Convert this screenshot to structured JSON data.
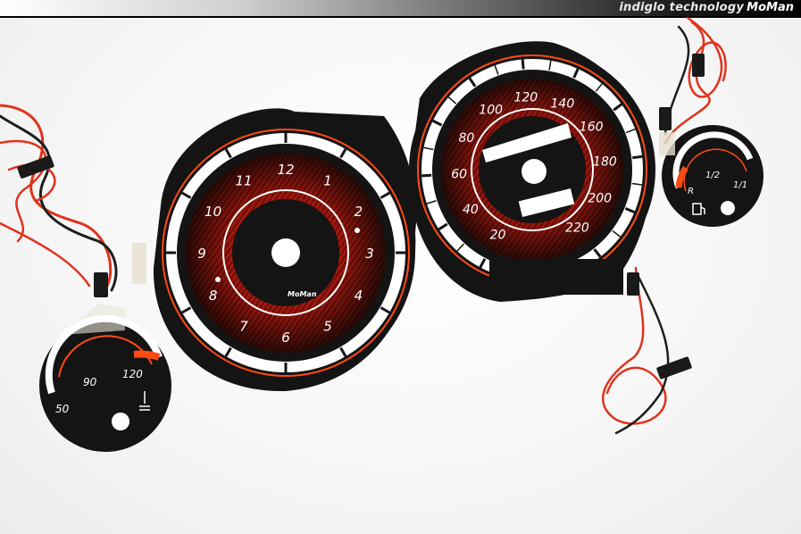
{
  "header": {
    "brand_text": "indiglo technology",
    "logo_text": "MoMan"
  },
  "clock": {
    "numbers": [
      "12",
      "1",
      "2",
      "3",
      "4",
      "5",
      "6",
      "7",
      "8",
      "9",
      "10",
      "11"
    ],
    "logo": "MoMan"
  },
  "speedometer": {
    "numbers": [
      "20",
      "40",
      "60",
      "80",
      "100",
      "120",
      "140",
      "160",
      "180",
      "200",
      "220"
    ]
  },
  "temperature": {
    "numbers": [
      "50",
      "90",
      "120"
    ]
  },
  "fuel": {
    "numbers": [
      "R",
      "1/2",
      "1/1"
    ]
  },
  "colors": {
    "gauge_black": "#141414",
    "gauge_red": "#c0281a",
    "accent_orange": "#ff4a14",
    "wire_red": "#e0331c"
  }
}
